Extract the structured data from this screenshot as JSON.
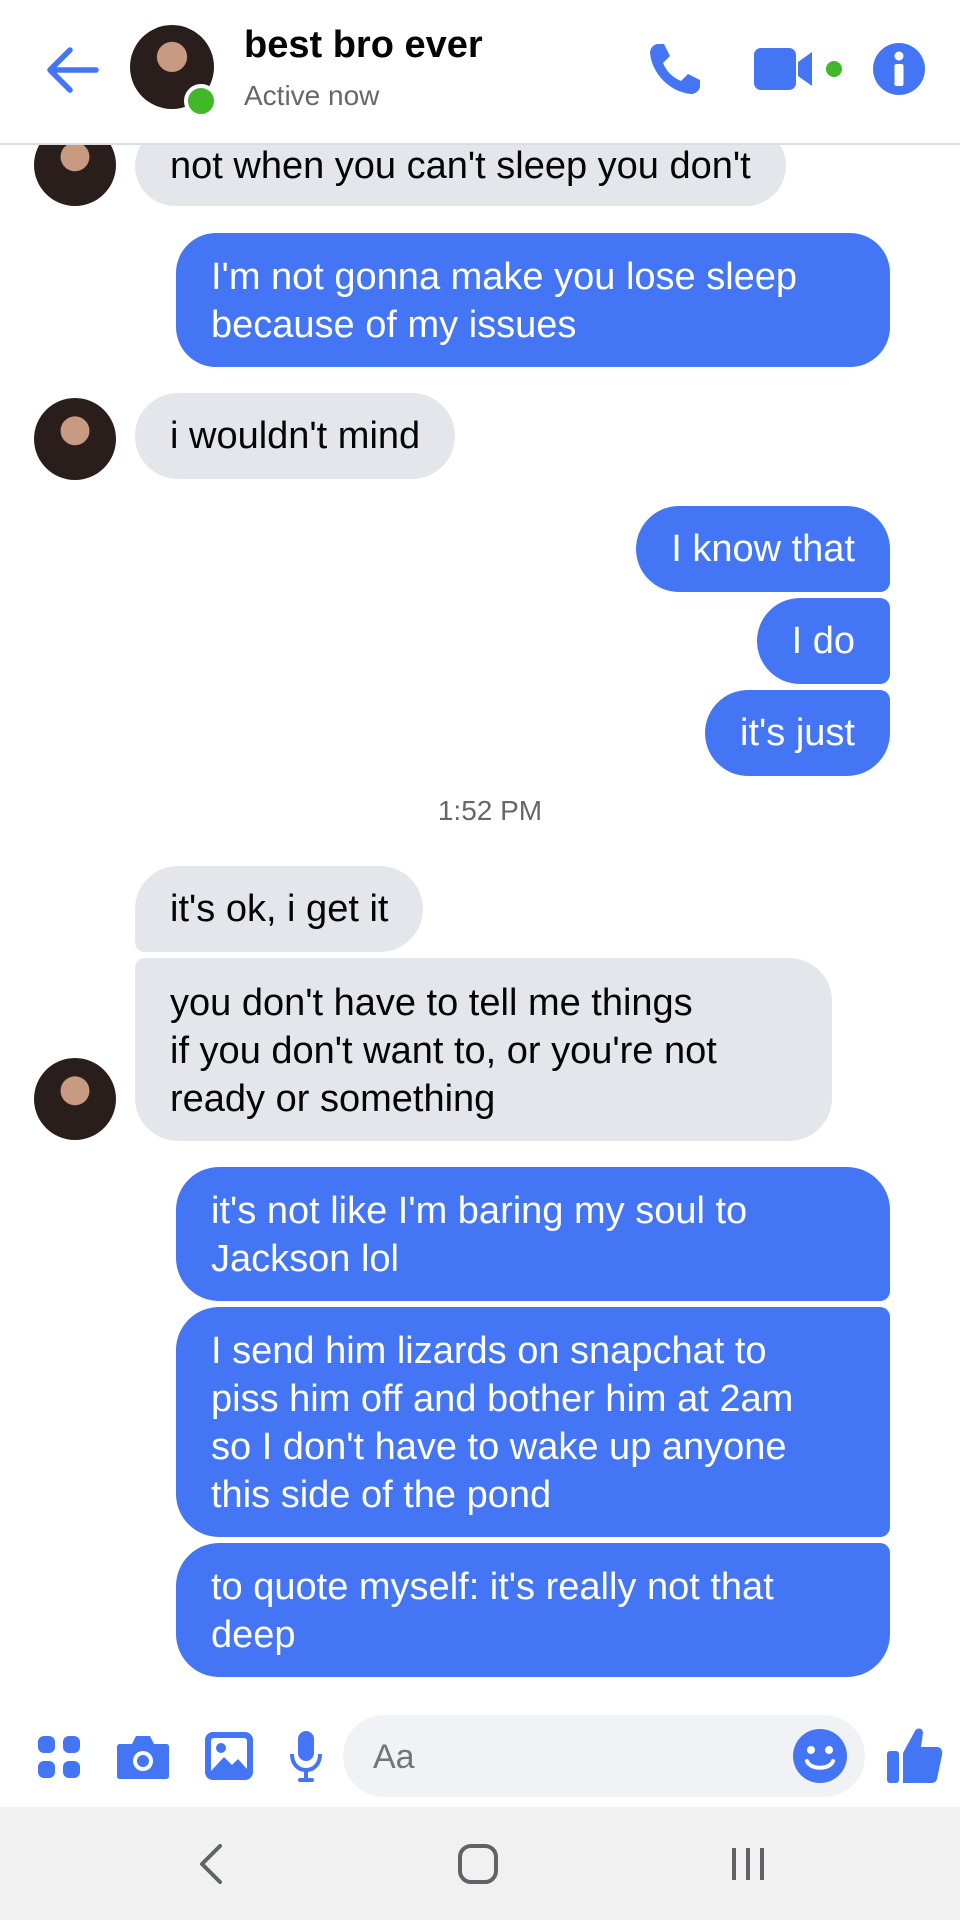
{
  "header": {
    "contact_name": "best bro ever",
    "status": "Active now"
  },
  "messages": [
    {
      "side": "received",
      "lines": [
        "not when you can't sleep you don't"
      ]
    },
    {
      "side": "sent",
      "lines": [
        "I'm not gonna make you lose sleep",
        "because of my issues"
      ]
    },
    {
      "side": "received",
      "lines": [
        "i wouldn't mind"
      ]
    },
    {
      "side": "sent",
      "lines": [
        "I know that"
      ]
    },
    {
      "side": "sent",
      "lines": [
        "I do"
      ]
    },
    {
      "side": "sent",
      "lines": [
        "it's just"
      ]
    },
    {
      "side": "received",
      "lines": [
        "it's ok, i get it"
      ]
    },
    {
      "side": "received",
      "lines": [
        "you don't have to tell me things",
        "if you don't want to, or you're not",
        "ready or something"
      ]
    },
    {
      "side": "sent",
      "lines": [
        "it's not like I'm baring my soul to",
        "Jackson lol"
      ]
    },
    {
      "side": "sent",
      "lines": [
        "I send him lizards on snapchat to",
        "piss him off and bother him at 2am",
        "so I don't have to wake up anyone",
        "this side of the pond"
      ]
    },
    {
      "side": "sent",
      "lines": [
        "to quote myself: it's really not that",
        "deep"
      ]
    }
  ],
  "timestamp": "1:52 PM",
  "composer": {
    "placeholder": "Aa"
  },
  "icons": {
    "back": "arrow-left-icon",
    "call": "phone-icon",
    "video": "video-camera-icon",
    "info": "info-icon",
    "apps": "grid-dots-icon",
    "camera": "camera-icon",
    "gallery": "image-icon",
    "mic": "microphone-icon",
    "emoji": "smiley-icon",
    "like": "thumbs-up-icon"
  },
  "colors": {
    "accent": "#4375f4",
    "received_bubble": "#e4e6eb",
    "online": "#42b72a"
  }
}
